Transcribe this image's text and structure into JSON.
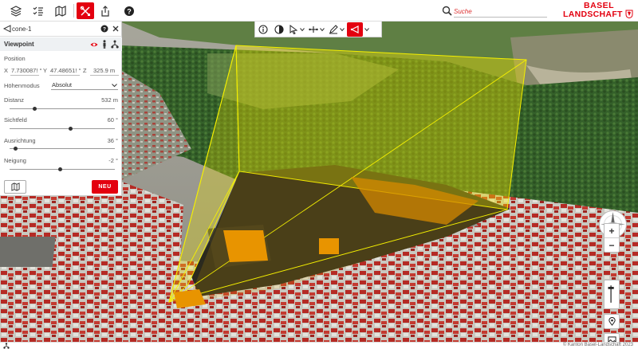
{
  "toolbar": {
    "search_placeholder": "Suche"
  },
  "logo": {
    "line1": "BASEL",
    "line2": "LANDSCHAFT"
  },
  "panel": {
    "title": "cone-1",
    "section": "Viewpoint",
    "position_label": "Position",
    "x_label": "X",
    "x_value": "7.730087! °",
    "y_label": "Y",
    "y_value": "47.48651! °",
    "z_label": "Z",
    "z_value": "325.9 m",
    "height_mode_label": "Höhenmodus",
    "height_mode_value": "Absolut",
    "distance_label": "Distanz",
    "distance_value": "532 m",
    "distance_level": 0.24,
    "fov_label": "Sichtfeld",
    "fov_value": "60 °",
    "fov_level": 0.58,
    "heading_label": "Ausrichtung",
    "heading_value": "36 °",
    "heading_level": 0.06,
    "pitch_label": "Neigung",
    "pitch_value": "-2 °",
    "pitch_level": 0.48,
    "new_label": "NEU"
  },
  "controls": {
    "zoom_in": "+",
    "zoom_out": "−",
    "compass_n": "N"
  },
  "footer": {
    "copyright": "© Kanton Basel-Landschaft 2023"
  },
  "colors": {
    "accent": "#e3000f",
    "cone_fill": "#f0e000",
    "cone_stroke": "#f5f000"
  }
}
